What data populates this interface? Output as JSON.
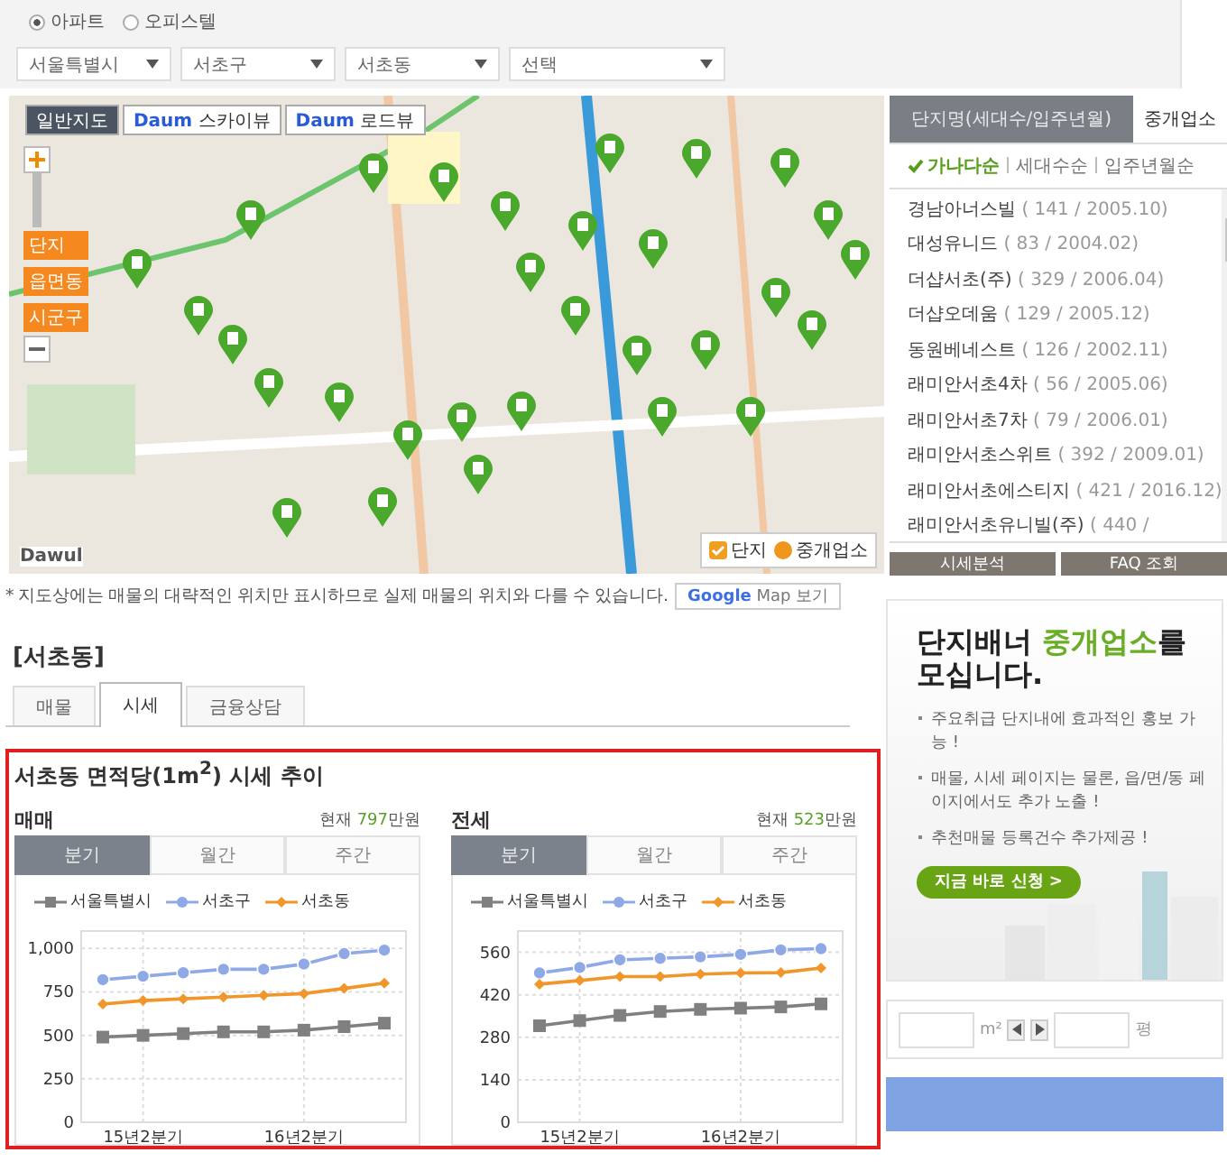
{
  "property_type": [
    {
      "label": "아파트",
      "selected": true
    },
    {
      "label": "오피스텔",
      "selected": false
    }
  ],
  "filters": [
    {
      "value": "서울특별시"
    },
    {
      "value": "서초구"
    },
    {
      "value": "서초동"
    },
    {
      "value": "선택"
    }
  ],
  "map": {
    "view_buttons": [
      {
        "kind": "text",
        "label": "일반지도",
        "selected": true
      },
      {
        "kind": "logo",
        "logo": "Daum",
        "label": "스카이뷰",
        "selected": false
      },
      {
        "kind": "logo",
        "logo": "Daum",
        "label": "로드뷰",
        "selected": false
      }
    ],
    "zoom_levels": [
      "단지",
      "읍면동",
      "시군구"
    ],
    "credit": "Dawul",
    "legend": [
      {
        "kind": "check",
        "label": "단지"
      },
      {
        "kind": "dot",
        "label": "중개업소"
      }
    ]
  },
  "complex_panel": {
    "tabs": [
      {
        "label": "단지명(세대수/입주년월)",
        "selected": true
      },
      {
        "label": "중개업소",
        "selected": false
      }
    ],
    "sort_options": [
      {
        "label": "가나다순",
        "selected": true
      },
      {
        "label": "세대수순",
        "selected": false
      },
      {
        "label": "입주년월순",
        "selected": false
      }
    ],
    "items": [
      {
        "name": "경남아너스빌",
        "detail": "( 141 / 2005.10)"
      },
      {
        "name": "대성유니드",
        "detail": "( 83 / 2004.02)"
      },
      {
        "name": "더샵서초(주)",
        "detail": "( 329 / 2006.04)"
      },
      {
        "name": "더샵오데움",
        "detail": "( 129 / 2005.12)"
      },
      {
        "name": "동원베네스트",
        "detail": "( 126 / 2002.11)"
      },
      {
        "name": "래미안서초4차",
        "detail": "( 56 / 2005.06)"
      },
      {
        "name": "래미안서초7차",
        "detail": "( 79 / 2006.01)"
      },
      {
        "name": "래미안서초스위트",
        "detail": "( 392 / 2009.01)"
      },
      {
        "name": "래미안서초에스티지",
        "detail": "( 421 / 2016.12)"
      },
      {
        "name": "래미안서초유니빌(주)",
        "detail": "( 440 /"
      }
    ],
    "buttons": [
      "시세분석",
      "FAQ 조회"
    ]
  },
  "note": "* 지도상에는 매물의 대략적인 위치만 표시하므로 실제 매물의 위치와 다를 수 있습니다.",
  "google_button": {
    "logo": "Google",
    "label": "Map 보기"
  },
  "area_heading": "[서초동]",
  "area_tabs": [
    {
      "label": "매물",
      "selected": false
    },
    {
      "label": "시세",
      "selected": true
    },
    {
      "label": "금융상담",
      "selected": false
    }
  ],
  "trend": {
    "title": "서초동 면적당(1m$^{2}$) 시세 추이",
    "panels": [
      {
        "name": "매매",
        "current_label": "현재",
        "current_value": "797",
        "current_unit": "만원",
        "periods": [
          {
            "label": "분기",
            "selected": true
          },
          {
            "label": "월간",
            "selected": false
          },
          {
            "label": "주간",
            "selected": false
          }
        ],
        "chart_data": {
          "type": "line",
          "categories": [
            null,
            "15년2분기",
            null,
            null,
            null,
            "16년2분기",
            null,
            null
          ],
          "ylim": [
            0,
            1100
          ],
          "grid": true,
          "legend": "top",
          "yticks": [
            0,
            250,
            500,
            750,
            {
              "value": 1000,
              "label": "1,000"
            }
          ],
          "series": [
            {
              "name": "서울특별시",
              "color": "#808080",
              "marker": "square",
              "values": [
                490,
                500,
                510,
                520,
                520,
                530,
                550,
                570
              ]
            },
            {
              "name": "서초구",
              "color": "#8fa9e6",
              "marker": "circle",
              "values": [
                820,
                840,
                860,
                880,
                880,
                910,
                970,
                990
              ]
            },
            {
              "name": "서초동",
              "color": "#f0962a",
              "marker": "diamond",
              "values": [
                680,
                700,
                710,
                720,
                730,
                740,
                770,
                800
              ]
            }
          ]
        }
      },
      {
        "name": "전세",
        "current_label": "현재",
        "current_value": "523",
        "current_unit": "만원",
        "periods": [
          {
            "label": "분기",
            "selected": true
          },
          {
            "label": "월간",
            "selected": false
          },
          {
            "label": "주간",
            "selected": false
          }
        ],
        "chart_data": {
          "type": "line",
          "categories": [
            null,
            "15년2분기",
            null,
            null,
            null,
            "16년2분기",
            null,
            null
          ],
          "ylim": [
            0,
            630
          ],
          "grid": true,
          "legend": "top",
          "yticks": [
            0,
            140,
            280,
            420,
            560
          ],
          "series": [
            {
              "name": "서울특별시",
              "color": "#808080",
              "marker": "square",
              "values": [
                318,
                335,
                352,
                365,
                372,
                376,
                380,
                390
              ]
            },
            {
              "name": "서초구",
              "color": "#8fa9e6",
              "marker": "circle",
              "values": [
                492,
                510,
                535,
                540,
                545,
                553,
                568,
                572
              ]
            },
            {
              "name": "서초동",
              "color": "#f0962a",
              "marker": "diamond",
              "values": [
                455,
                467,
                480,
                480,
                488,
                492,
                493,
                508
              ]
            }
          ]
        }
      }
    ]
  },
  "banner": {
    "title": "단지배너 **중개업소**를 모십니다.",
    "bullets": [
      "주요취급 단지내에 효과적인 홍보 가능 !",
      "매물, 시세 페이지는 물론, 읍/면/동 페이지에서도 추가 노출 !",
      "추천매물 등록건수 추가제공 !"
    ],
    "button": "지금 바로 신청 >"
  },
  "converter": {
    "unit_left": "m²",
    "unit_right": "평"
  }
}
